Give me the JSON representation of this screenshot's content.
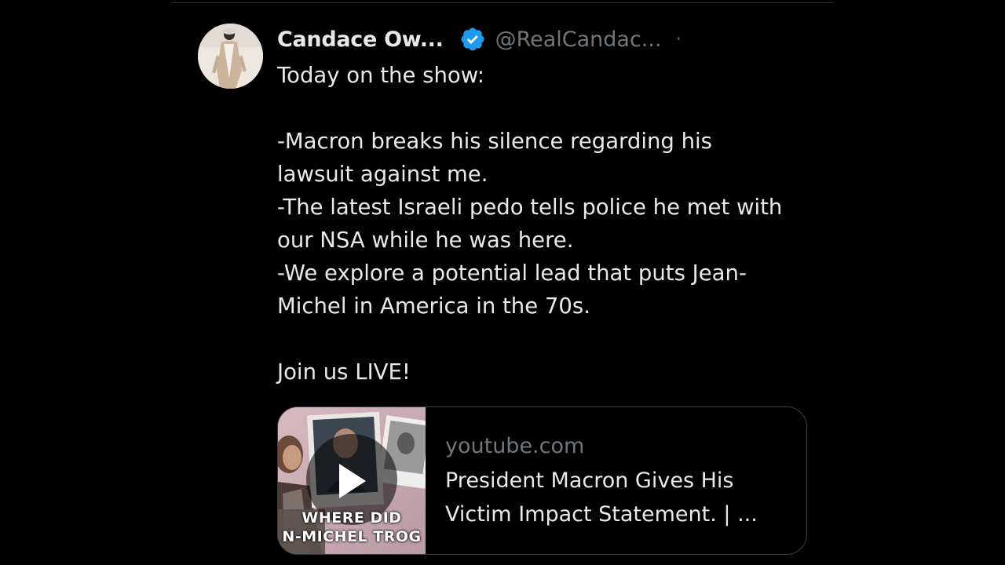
{
  "tweet": {
    "author_name": "Candace Ow...",
    "author_handle": "@RealCandac...",
    "separator": "·",
    "body_lines": [
      "Today on the show:",
      "",
      "-Macron breaks his silence regarding his",
      "lawsuit against me.",
      "-The latest Israeli pedo tells police he met with",
      "our NSA while he was here.",
      "-We explore a potential lead that puts Jean-",
      "Michel in America in the 70s.",
      "",
      "Join us LIVE!"
    ]
  },
  "link_card": {
    "domain": "youtube.com",
    "title_line1": "President Macron Gives His",
    "title_line2": "Victim Impact Statement. | ...",
    "thumbnail_caption_line1": "WHERE DID",
    "thumbnail_caption_line2": "N-MICHEL TROG"
  },
  "icons": {
    "verified": "verified-badge-icon",
    "play": "play-icon"
  },
  "colors": {
    "background": "#000000",
    "text_primary": "#e7e9ea",
    "text_secondary": "#71767b",
    "verified_blue": "#1d9bf0",
    "border": "#3a3d41"
  }
}
